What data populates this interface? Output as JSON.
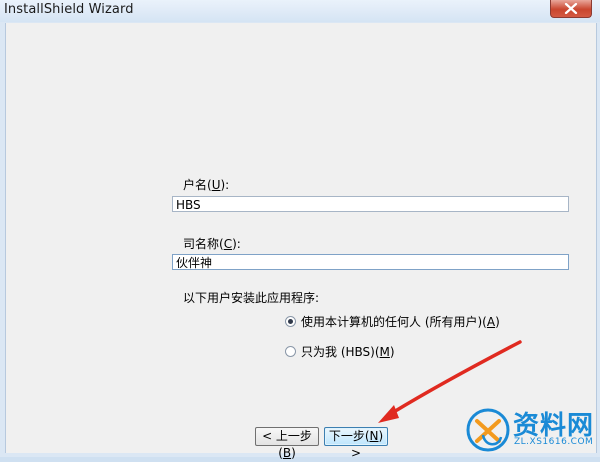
{
  "window": {
    "title": "InstallShield Wizard"
  },
  "form": {
    "user_label": "户名(U):",
    "user_value": "HBS",
    "org_label": "司名称(C):",
    "org_value": "伙伴神",
    "install_for_label": "以下用户安装此应用程序:",
    "options": [
      {
        "label": "使用本计算机的任何人 (所有用户)(A)",
        "selected": true
      },
      {
        "label": "只为我 (HBS)(M)",
        "selected": false
      }
    ]
  },
  "buttons": {
    "back": "< 上一步(B)",
    "next": "下一步(N) >"
  },
  "watermark": {
    "name": "资料网",
    "url": "ZL.XS1616.COM"
  },
  "colors": {
    "arrow": "#e02a20",
    "watermark": "#1a8ad6",
    "default_button_border": "#3c7fb1"
  }
}
